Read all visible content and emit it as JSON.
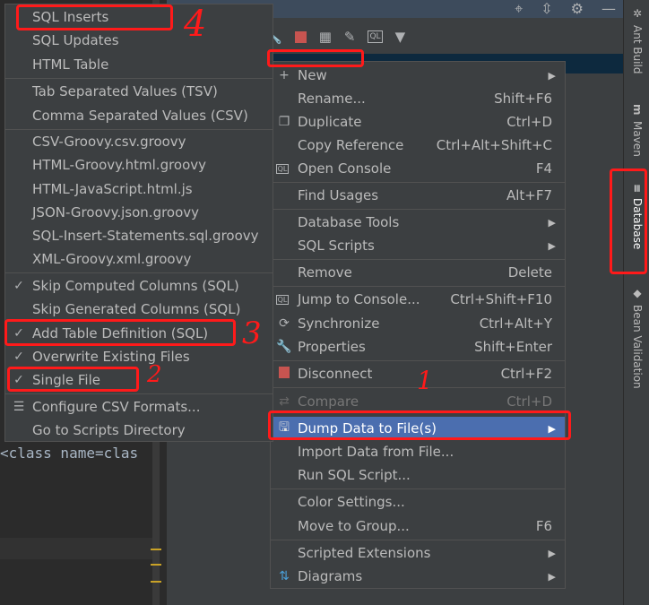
{
  "editor": {
    "code_line": "<class name=clas"
  },
  "right_strip": {
    "tabs": [
      "Ant Build",
      "Maven",
      "Database",
      "Bean Validation"
    ]
  },
  "submenu": {
    "items": [
      {
        "label": "SQL Inserts"
      },
      {
        "label": "SQL Updates"
      },
      {
        "label": "HTML Table"
      },
      {
        "label": "Tab Separated Values (TSV)"
      },
      {
        "label": "Comma Separated Values (CSV)"
      },
      {
        "label": "CSV-Groovy.csv.groovy"
      },
      {
        "label": "HTML-Groovy.html.groovy"
      },
      {
        "label": "HTML-JavaScript.html.js"
      },
      {
        "label": "JSON-Groovy.json.groovy"
      },
      {
        "label": "SQL-Insert-Statements.sql.groovy"
      },
      {
        "label": "XML-Groovy.xml.groovy"
      },
      {
        "label": "Skip Computed Columns (SQL)",
        "checked": true
      },
      {
        "label": "Skip Generated Columns (SQL)",
        "checked": false
      },
      {
        "label": "Add Table Definition (SQL)",
        "checked": true
      },
      {
        "label": "Overwrite Existing Files",
        "checked": true
      },
      {
        "label": "Single File",
        "checked": true
      },
      {
        "label": "Configure CSV Formats...",
        "icon": "sliders-icon"
      },
      {
        "label": "Go to Scripts Directory"
      }
    ]
  },
  "context_menu": {
    "items": [
      {
        "label": "New",
        "icon": "plus-icon",
        "submenu": true
      },
      {
        "label": "Rename...",
        "shortcut": "Shift+F6"
      },
      {
        "label": "Duplicate",
        "icon": "copy-icon",
        "shortcut": "Ctrl+D"
      },
      {
        "label": "Copy Reference",
        "shortcut": "Ctrl+Alt+Shift+C"
      },
      {
        "label": "Open Console",
        "icon": "console-icon",
        "shortcut": "F4"
      },
      {
        "label": "Find Usages",
        "shortcut": "Alt+F7"
      },
      {
        "label": "Database Tools",
        "submenu": true
      },
      {
        "label": "SQL Scripts",
        "submenu": true
      },
      {
        "label": "Remove",
        "shortcut": "Delete"
      },
      {
        "label": "Jump to Console...",
        "icon": "console-icon",
        "shortcut": "Ctrl+Shift+F10"
      },
      {
        "label": "Synchronize",
        "icon": "sync-icon",
        "shortcut": "Ctrl+Alt+Y"
      },
      {
        "label": "Properties",
        "icon": "wrench-icon",
        "shortcut": "Shift+Enter"
      },
      {
        "label": "Disconnect",
        "icon": "stop-icon",
        "shortcut": "Ctrl+F2"
      },
      {
        "label": "Compare",
        "icon": "compare-icon",
        "shortcut": "Ctrl+D",
        "disabled": true
      },
      {
        "label": "Dump Data to File(s)",
        "icon": "save-icon",
        "submenu": true,
        "active": true
      },
      {
        "label": "Import Data from File..."
      },
      {
        "label": "Run SQL Script..."
      },
      {
        "label": "Color Settings..."
      },
      {
        "label": "Move to Group...",
        "shortcut": "F6"
      },
      {
        "label": "Scripted Extensions",
        "submenu": true
      },
      {
        "label": "Diagrams",
        "icon": "diagram-icon",
        "submenu": true
      }
    ]
  },
  "annotations": [
    "1",
    "2",
    "3",
    "4"
  ],
  "colors": {
    "highlight": "#4b6eaf",
    "annotation": "#ff1a1a",
    "menu_bg": "#3c3f41"
  }
}
